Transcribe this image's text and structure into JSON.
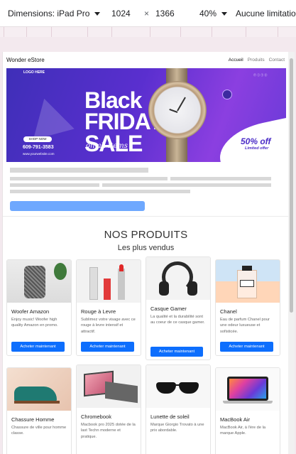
{
  "devtools": {
    "device": "Dimensions: iPad Pro",
    "width": "1024",
    "times": "×",
    "height": "1366",
    "zoom": "40%",
    "throttle": "Aucune limitatio"
  },
  "site": {
    "brand": "Wonder eStore",
    "nav": [
      "Accueil",
      "Produits",
      "Contact"
    ]
  },
  "banner": {
    "logo": "LOGO HERE",
    "headline_1": "Black",
    "headline_2": "FRIDAY",
    "headline_3": "SALE",
    "script": "on all items",
    "cta": "SHOP NOW",
    "phone": "609-791-3583",
    "website": "www.yourwebsite.com",
    "discount": "50% off",
    "discount_sub": "Limited offer",
    "social": "ⓕ ⓘ ⓣ ⓨ"
  },
  "products": {
    "title": "NOS PRODUITS",
    "subtitle": "Les plus vendus",
    "items": [
      {
        "name": "Woofer Amazon",
        "desc": "Enjoy music! Woofer high quality Amazon en promo.",
        "button": "Acheter maintenant",
        "image": "speaker"
      },
      {
        "name": "Rouge à Levre",
        "desc": "Sublimez votre visage avec ce rouge à levre intensif et attractif.",
        "button": "Acheter maintenant",
        "image": "lipstick"
      },
      {
        "name": "Casque Gamer",
        "desc": "La qualité et la durabilité sont au coeur de ce casque gamer.",
        "button": "Acheter maintenant",
        "image": "headphones"
      },
      {
        "name": "Chanel",
        "desc": "Eau de parfum Chanel pour une odeur luxueuse et sofisticée.",
        "button": "Acheter maintenant",
        "image": "perfume"
      },
      {
        "name": "Chassure Homme",
        "desc": "Chassure de ville pour homme classe.",
        "button": "",
        "image": "shoe"
      },
      {
        "name": "Chromebook",
        "desc": "Macbook pro 2025 dotée de la last Techn moderne et pratique.",
        "button": "",
        "image": "laptop"
      },
      {
        "name": "Lunette de soleil",
        "desc": "Marque Giorgio Trovato à une prix abordable.",
        "button": "",
        "image": "sunglasses"
      },
      {
        "name": "MacBook Air",
        "desc": "MacBook Air, à l'ère de la marque Apple.",
        "button": "",
        "image": "macbook"
      }
    ]
  },
  "colors": {
    "primary_button": "#0d6efd",
    "skeleton_button": "#6ea8fe",
    "banner_purple": "#5a2fcf"
  }
}
